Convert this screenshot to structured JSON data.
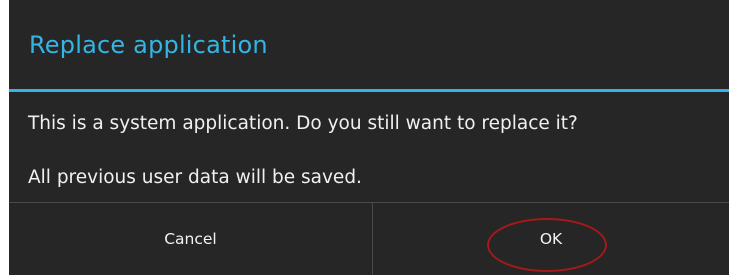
{
  "dialog": {
    "title": "Replace application",
    "message_line1": "This is a system application. Do you still want to replace it?",
    "message_line2": "All previous user data will be saved.",
    "buttons": {
      "cancel_label": "Cancel",
      "ok_label": "OK"
    }
  },
  "colors": {
    "dialog_background": "#262626",
    "accent": "#33b5e5",
    "annotation": "#a51919"
  }
}
